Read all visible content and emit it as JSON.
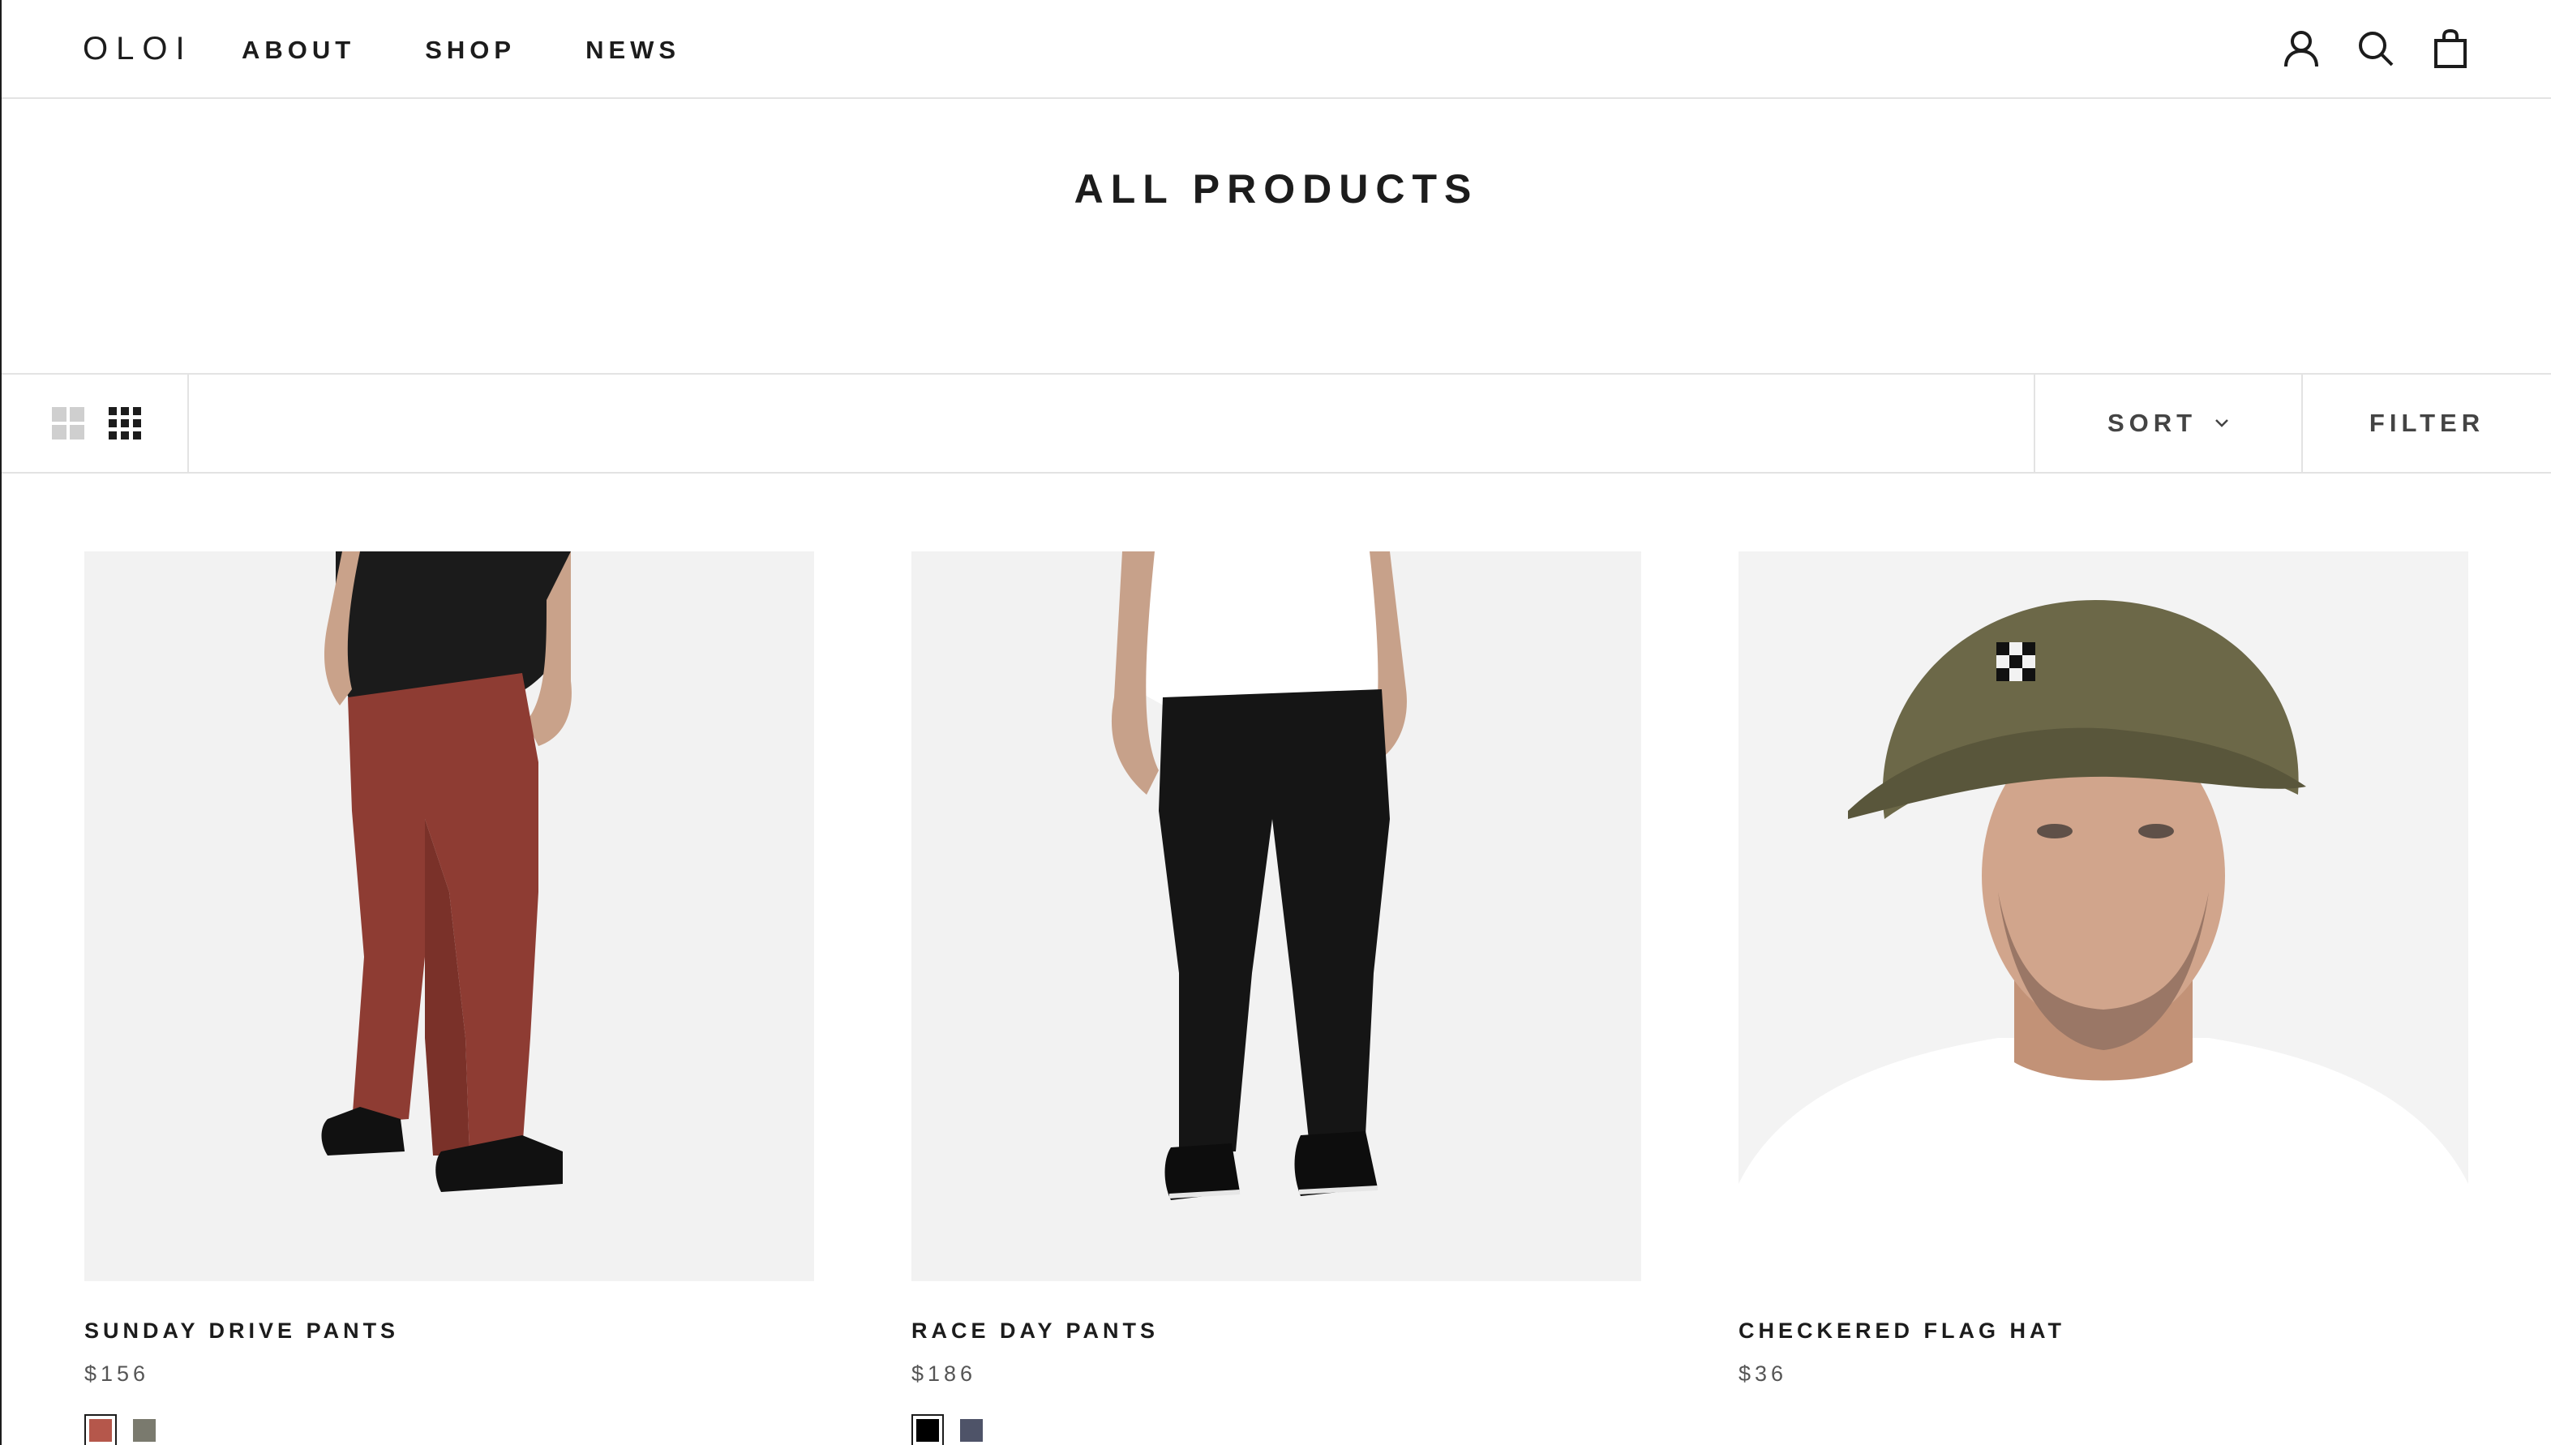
{
  "header": {
    "logo": "OLOI",
    "nav": [
      {
        "label": "ABOUT"
      },
      {
        "label": "SHOP"
      },
      {
        "label": "NEWS"
      }
    ],
    "icons": [
      "account-icon",
      "search-icon",
      "cart-icon"
    ]
  },
  "collection": {
    "title": "ALL PRODUCTS"
  },
  "toolbar": {
    "layouts": [
      "grid-2-icon",
      "grid-4-icon"
    ],
    "sort_label": "SORT",
    "filter_label": "FILTER"
  },
  "products": [
    {
      "title": "SUNDAY DRIVE PANTS",
      "price": "$156",
      "swatches": [
        {
          "color": "#b5574b",
          "selected": true
        },
        {
          "color": "#7a7a6e",
          "selected": false
        }
      ]
    },
    {
      "title": "RACE DAY PANTS",
      "price": "$186",
      "swatches": [
        {
          "color": "#000000",
          "selected": true
        },
        {
          "color": "#4e5368",
          "selected": false
        }
      ]
    },
    {
      "title": "CHECKERED FLAG HAT",
      "price": "$36",
      "swatches": []
    }
  ],
  "colors": {
    "text": "#1c1c1c",
    "border": "#e3e3e3",
    "image_bg": "#f2f2f2"
  }
}
